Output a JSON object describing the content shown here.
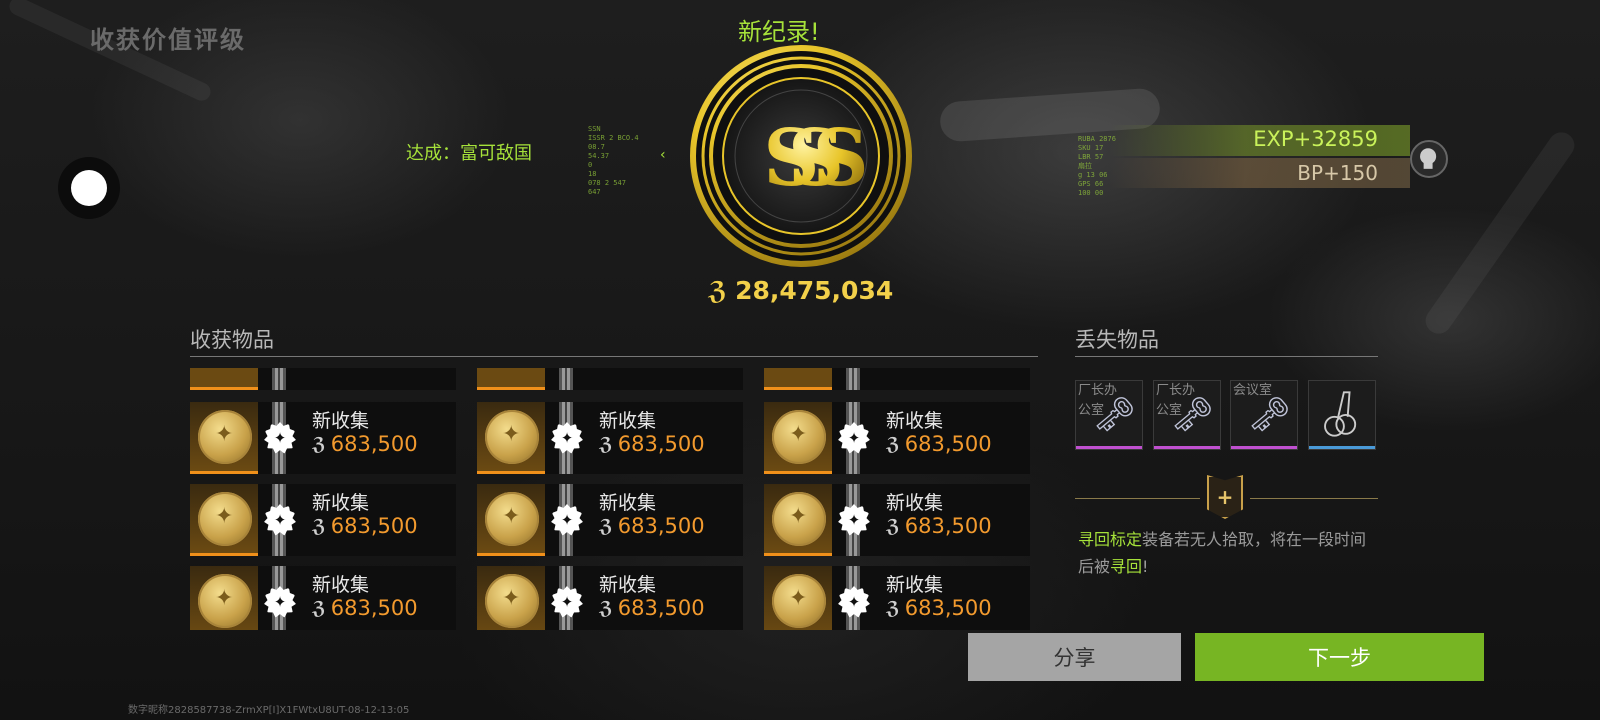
{
  "header": {
    "title": "收获价值评级"
  },
  "rating": {
    "record_text": "新纪录!",
    "achievement": "达成：富可敌国",
    "grade": "SSS",
    "total_value": "28,475,034",
    "exp": "EXP+32859",
    "bp": "BP+150"
  },
  "hud_text": {
    "left": [
      "SSN",
      "ISSR 2 BCO.4",
      "08.7",
      "54.37",
      "0",
      "18",
      "078 2 547",
      "647"
    ],
    "right": [
      "RUBA 2876",
      "SKU 17",
      "LBR 57",
      "扇拉",
      "g 13 06",
      "GPS 66",
      "100 00"
    ]
  },
  "collected": {
    "title": "收获物品",
    "items": [
      {
        "label": "新收集",
        "price": "683,500"
      },
      {
        "label": "新收集",
        "price": "683,500"
      },
      {
        "label": "新收集",
        "price": "683,500"
      },
      {
        "label": "新收集",
        "price": "683,500"
      },
      {
        "label": "新收集",
        "price": "683,500"
      },
      {
        "label": "新收集",
        "price": "683,500"
      },
      {
        "label": "新收集",
        "price": "683,500"
      },
      {
        "label": "新收集",
        "price": "683,500"
      },
      {
        "label": "新收集",
        "price": "683,500"
      }
    ],
    "rarity_color": "#f0901a",
    "badge_icon": "star-badge-icon"
  },
  "lost": {
    "title": "丢失物品",
    "items": [
      {
        "label": "厂长办公室",
        "icon": "key-icon",
        "rarity_color": "#c050d0"
      },
      {
        "label": "厂长办公室",
        "icon": "key-icon",
        "rarity_color": "#c050d0"
      },
      {
        "label": "会议室",
        "icon": "key-icon",
        "rarity_color": "#c050d0"
      },
      {
        "label": "",
        "icon": "keyring-icon",
        "rarity_color": "#4a9ad8"
      }
    ]
  },
  "recall_note": {
    "part1": "寻回标定",
    "part2": "装备若无人拾取，将在一段时间后被",
    "part3": "寻回",
    "part4": "!"
  },
  "actions": {
    "share": "分享",
    "next": "下一步"
  },
  "footer": {
    "id_text": "数字昵称2828587738-ZrmXP[I]X1FWtxU8UT-08-12-13:05"
  },
  "colors": {
    "accent_green": "#a6e23a",
    "gold": "#f2d04a",
    "orange": "#f29a2e"
  }
}
